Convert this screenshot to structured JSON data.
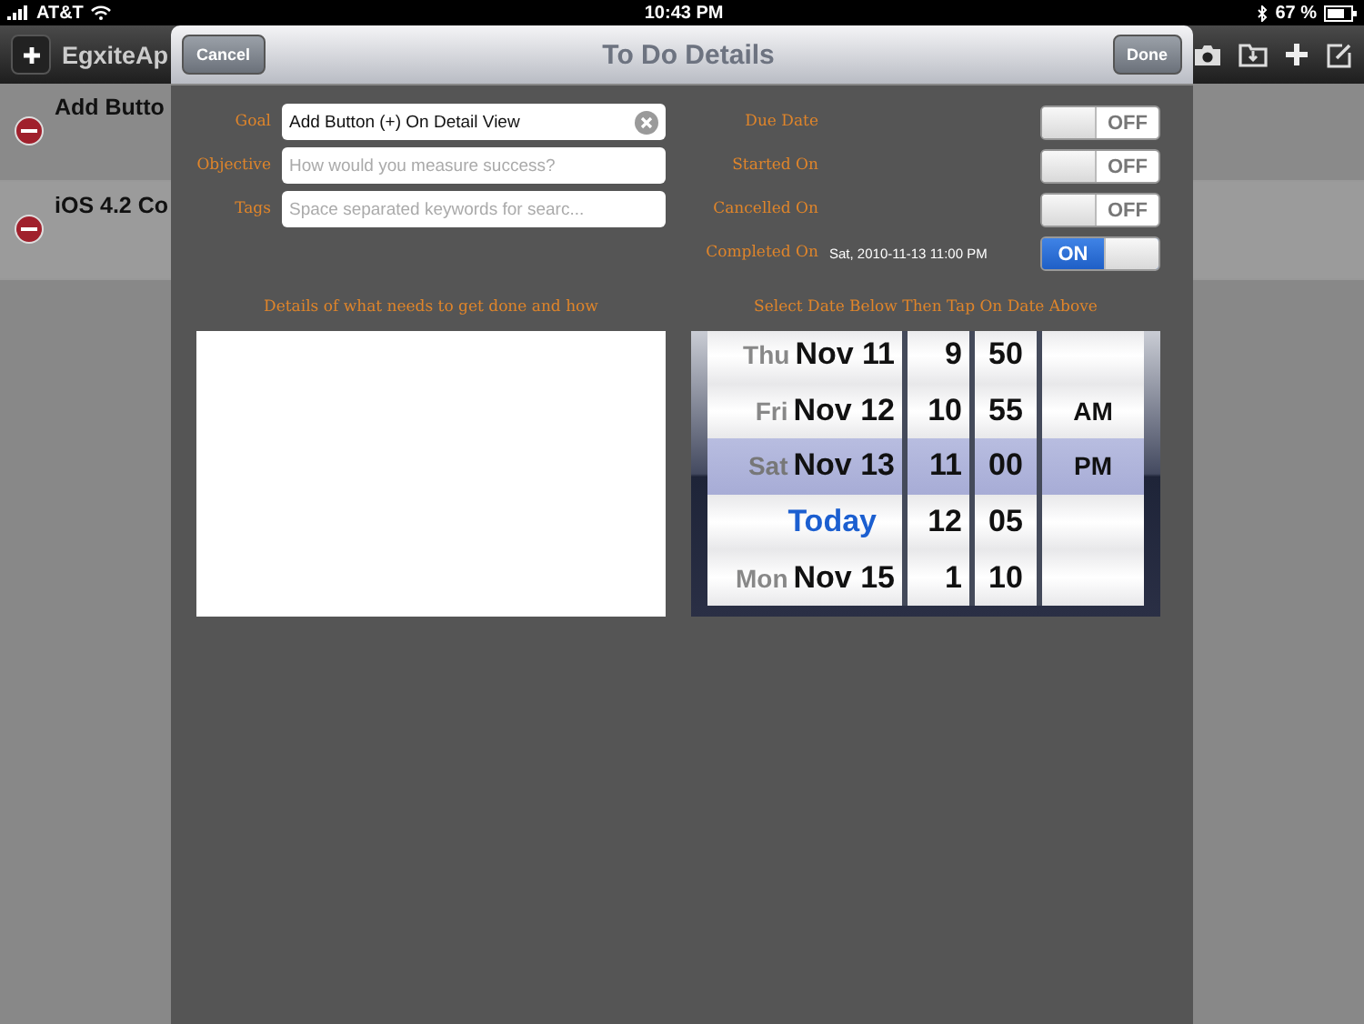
{
  "status_bar": {
    "carrier": "AT&T",
    "time": "10:43 PM",
    "battery": "67 %"
  },
  "background": {
    "title": "EgxiteAp",
    "rows": [
      {
        "title": "Add Butto",
        "selected": false
      },
      {
        "title": "iOS 4.2 Co",
        "selected": true
      }
    ]
  },
  "dialog": {
    "title": "To Do Details",
    "cancel": "Cancel",
    "done": "Done",
    "fields": [
      {
        "label": "Goal",
        "value": "Add Button (+) On Detail View",
        "clearable": true
      },
      {
        "label": "Objective",
        "placeholder": "How would you measure success?",
        "clearable": false
      },
      {
        "label": "Tags",
        "placeholder": "Space separated keywords for searc...",
        "clearable": false
      }
    ],
    "toggles": [
      {
        "label": "Due Date",
        "on": false,
        "state": "OFF"
      },
      {
        "label": "Started On",
        "on": false,
        "state": "OFF"
      },
      {
        "label": "Cancelled On",
        "on": false,
        "state": "OFF"
      },
      {
        "label": "Completed On",
        "value": "Sat, 2010-11-13 11:00 PM",
        "on": true,
        "state": "ON"
      }
    ],
    "details_label": "Details of what needs to get done and how",
    "picker_label": "Select Date Below Then Tap On Date Above",
    "picker_rows": [
      {
        "weekday": "Thu",
        "date": "Nov 11",
        "hour": "9",
        "minute": "50",
        "selected": false
      },
      {
        "weekday": "Fri",
        "date": "Nov 12",
        "hour": "10",
        "minute": "55",
        "ampm": "AM",
        "selected": false
      },
      {
        "weekday": "Sat",
        "date": "Nov 13",
        "hour": "11",
        "minute": "00",
        "ampm": "PM",
        "selected": true
      },
      {
        "today": "Today",
        "hour": "12",
        "minute": "05",
        "selected": false
      },
      {
        "weekday": "Mon",
        "date": "Nov 15",
        "hour": "1",
        "minute": "10",
        "selected": false
      }
    ]
  }
}
